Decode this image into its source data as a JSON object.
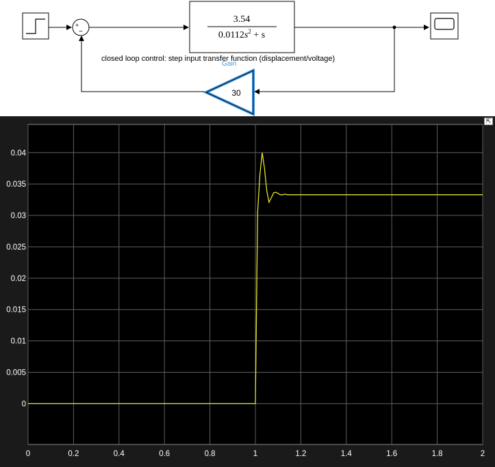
{
  "diagram": {
    "transfer_function": {
      "numerator": "3.54",
      "denominator_coef": "0.0112",
      "denominator_rest": " + s"
    },
    "sum_signs": {
      "plus": "+",
      "minus": "−"
    },
    "caption": "closed loop control: step input transfer function (displacement/voltage)",
    "gain": {
      "label": "Gain",
      "value": "30"
    }
  },
  "scope": {
    "restore_icon": "restore-icon",
    "colors": {
      "background": "#000000",
      "grid": "#606060",
      "signal": "#e5e52e",
      "axes_text": "#ffffff",
      "frame": "#1a1a1a"
    }
  },
  "chart_data": {
    "type": "line",
    "title": "",
    "xlabel": "",
    "ylabel": "",
    "xlim": [
      0,
      2
    ],
    "ylim": [
      -0.0065,
      0.0445
    ],
    "grid": true,
    "xticks": [
      0,
      0.2,
      0.4,
      0.6,
      0.8,
      1,
      1.2,
      1.4,
      1.6,
      1.8,
      2
    ],
    "xtick_labels": [
      "0",
      "0.2",
      "0.4",
      "0.6",
      "0.8",
      "1",
      "1.2",
      "1.4",
      "1.6",
      "1.8",
      "2"
    ],
    "yticks": [
      0,
      0.005,
      0.01,
      0.015,
      0.02,
      0.025,
      0.03,
      0.035,
      0.04
    ],
    "ytick_labels": [
      "0",
      "0.005",
      "0.01",
      "0.015",
      "0.02",
      "0.025",
      "0.03",
      "0.035",
      "0.04"
    ],
    "series": [
      {
        "x": [
          0,
          1.0,
          1.01,
          1.02,
          1.03,
          1.04,
          1.05,
          1.06,
          1.07,
          1.08,
          1.09,
          1.1,
          1.11,
          1.12,
          1.13,
          1.14,
          1.2,
          1.5,
          2.0
        ],
        "y": [
          0,
          0,
          0.0305,
          0.0365,
          0.04,
          0.0375,
          0.034,
          0.0321,
          0.0328,
          0.0336,
          0.0337,
          0.0335,
          0.0333,
          0.0333,
          0.0334,
          0.0333,
          0.0333,
          0.0333,
          0.0333
        ]
      }
    ]
  }
}
